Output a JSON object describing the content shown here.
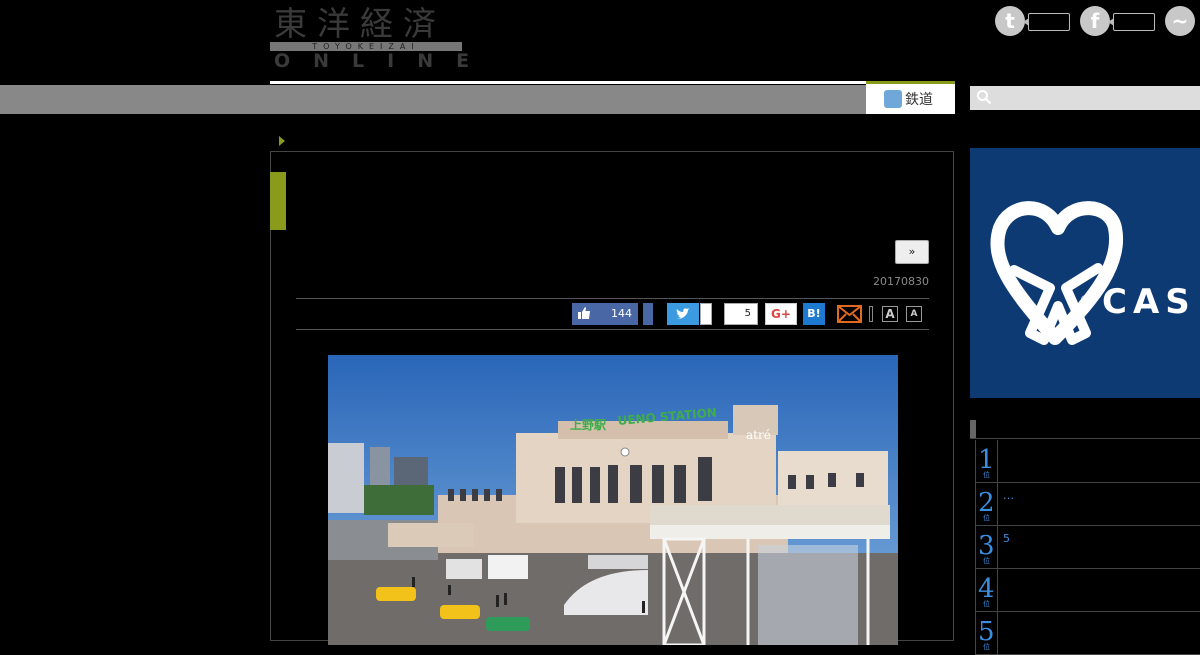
{
  "header": {
    "logo": {
      "kanji": "東洋経済",
      "romaji": "TOYOKEIZAI",
      "online": "ONLINE"
    },
    "social": [
      {
        "name": "twitter",
        "glyph": "t"
      },
      {
        "name": "facebook",
        "glyph": "f"
      },
      {
        "name": "messenger",
        "glyph": "~"
      }
    ]
  },
  "nav": {
    "active_tab": "鉄道",
    "accent_color": "#8a9a1a",
    "search_placeholder": ""
  },
  "article": {
    "more_button": "»",
    "date": "20170830",
    "share": {
      "facebook_like_count": "144",
      "pocket_count": "5",
      "gplus_label": "G+",
      "hatena_label": "B!",
      "font_large": "A",
      "font_small": "A"
    },
    "photo": {
      "sign_jp": "上野駅",
      "sign_en": "UENO STATION",
      "atre_label": "atré"
    }
  },
  "sidebar": {
    "ad_brand": "CAS",
    "ad_color": "#0d3a73",
    "ranking": [
      {
        "rank": "1",
        "unit": "位",
        "text": ""
      },
      {
        "rank": "2",
        "unit": "位",
        "text": "…"
      },
      {
        "rank": "3",
        "unit": "位",
        "text": "5"
      },
      {
        "rank": "4",
        "unit": "位",
        "text": ""
      },
      {
        "rank": "5",
        "unit": "位",
        "text": ""
      }
    ]
  }
}
